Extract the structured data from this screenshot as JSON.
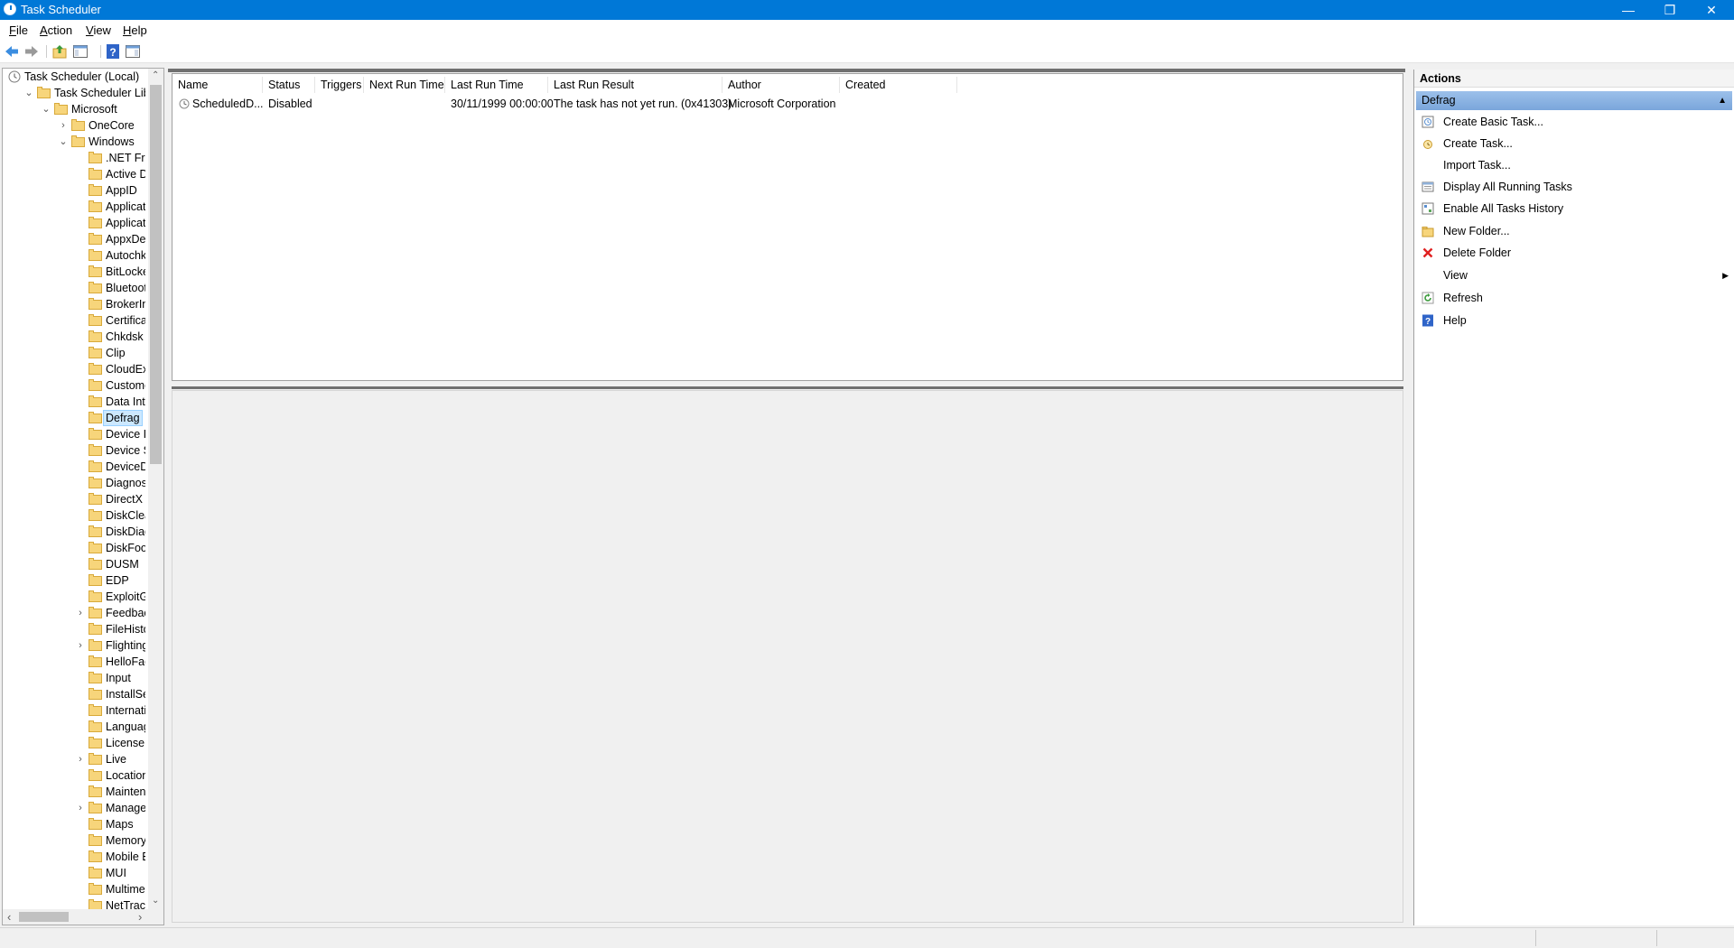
{
  "window": {
    "title": "Task Scheduler",
    "minimize": "—",
    "restore": "❐",
    "close": "✕"
  },
  "menu": [
    {
      "acc": "F",
      "rest": "ile"
    },
    {
      "acc": "A",
      "rest": "ction"
    },
    {
      "acc": "V",
      "rest": "iew"
    },
    {
      "acc": "H",
      "rest": "elp"
    }
  ],
  "toolbar": {
    "icons": [
      "back-arrow-icon",
      "forward-arrow-icon",
      "up-folder-icon",
      "show-hide-console-tree-icon",
      "help-icon",
      "show-hide-action-pane-icon"
    ]
  },
  "tree": {
    "root": "Task Scheduler (Local)",
    "library": "Task Scheduler Library",
    "microsoft": "Microsoft",
    "onecore": "OneCore",
    "windows": "Windows",
    "folders": [
      ".NET Frame",
      "Active Direc",
      "AppID",
      "Application",
      "Application",
      "AppxDeplo",
      "Autochk",
      "BitLocker",
      "Bluetooth",
      "BrokerInfra",
      "CertificateS",
      "Chkdsk",
      "Clip",
      "CloudExper",
      "Customer E",
      "Data Integri",
      "Defrag",
      "Device Info",
      "Device Setu",
      "DeviceDirec",
      "Diagnosis",
      "DirectX",
      "DiskCleanu",
      "DiskDiagno",
      "DiskFootpri",
      "DUSM",
      "EDP",
      "ExploitGuar",
      "Feedback",
      "FileHistory",
      "Flighting",
      "HelloFace",
      "Input",
      "InstallServic",
      "Internation",
      "LanguageC",
      "License Ma",
      "Live",
      "Location",
      "Maintenanc",
      "Manageme",
      "Maps",
      "MemoryDia",
      "Mobile Bro",
      "MUI",
      "Multimedia",
      "NetTrace"
    ],
    "expandable_indices": [
      28,
      30,
      37,
      40
    ],
    "selected_index": 16,
    "scroll_up": "⌃",
    "scroll_down": "⌄",
    "scroll_left": "‹",
    "scroll_right": "›"
  },
  "tasklist": {
    "columns": [
      "Name",
      "Status",
      "Triggers",
      "Next Run Time",
      "Last Run Time",
      "Last Run Result",
      "Author",
      "Created"
    ],
    "rows": [
      {
        "name": "ScheduledD...",
        "status": "Disabled",
        "triggers": "",
        "next_run": "",
        "last_run": "30/11/1999 00:00:00",
        "result": "The task has not yet run. (0x41303)",
        "author": "Microsoft Corporation",
        "created": ""
      }
    ]
  },
  "actions": {
    "header": "Actions",
    "section": "Defrag",
    "collapse_glyph": "▲",
    "items": [
      {
        "label": "Create Basic Task...",
        "icon": "create-basic-task-icon"
      },
      {
        "label": "Create Task...",
        "icon": "create-task-icon"
      },
      {
        "label": "Import Task...",
        "icon": ""
      },
      {
        "label": "Display All Running Tasks",
        "icon": "running-tasks-icon"
      },
      {
        "label": "Enable All Tasks History",
        "icon": "tasks-history-icon"
      },
      {
        "label": "New Folder...",
        "icon": "new-folder-icon"
      },
      {
        "label": "Delete Folder",
        "icon": "delete-icon"
      },
      {
        "label": "View",
        "icon": ""
      },
      {
        "label": "Refresh",
        "icon": "refresh-icon"
      },
      {
        "label": "Help",
        "icon": "help-icon"
      }
    ],
    "submenu_glyph": "▶"
  },
  "colors": {
    "titlebar": "#0078d7",
    "selection": "#cce8ff",
    "section_header": "#9cc0ea"
  }
}
